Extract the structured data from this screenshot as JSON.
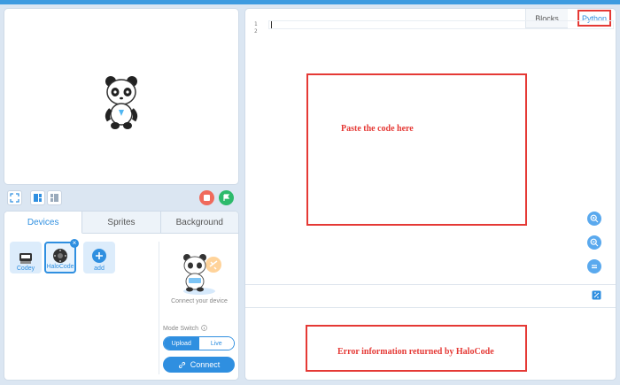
{
  "left": {
    "tabs": [
      "Devices",
      "Sprites",
      "Background"
    ],
    "devices": [
      {
        "label": "Codey",
        "selected": false
      },
      {
        "label": "HaloCode",
        "selected": true
      },
      {
        "label": "add",
        "selected": false
      }
    ],
    "connect_caption": "Connect your device",
    "mode_switch_label": "Mode Switch",
    "mode_options": {
      "upload": "Upload",
      "live": "Live",
      "selected": "upload"
    },
    "connect_button": "Connect"
  },
  "editor": {
    "tabs": {
      "blocks": "Blocks",
      "python": "Python",
      "active": "python"
    },
    "line_numbers": [
      "1",
      "2"
    ],
    "annotations": {
      "paste_code": "Paste the code here",
      "error_info": "Error information returned by HaloCode"
    }
  },
  "colors": {
    "accent": "#2f8fe0",
    "annotation_red": "#e53935",
    "stop_button": "#f06a5c",
    "go_button": "#2dba6b"
  },
  "icons": [
    "fullscreen-icon",
    "layout-large-icon",
    "layout-small-icon",
    "stop-icon",
    "green-flag-icon",
    "zoom-in-icon",
    "zoom-out-icon",
    "zoom-reset-icon",
    "console-toggle-icon",
    "link-icon",
    "info-icon",
    "add-icon",
    "close-icon"
  ]
}
